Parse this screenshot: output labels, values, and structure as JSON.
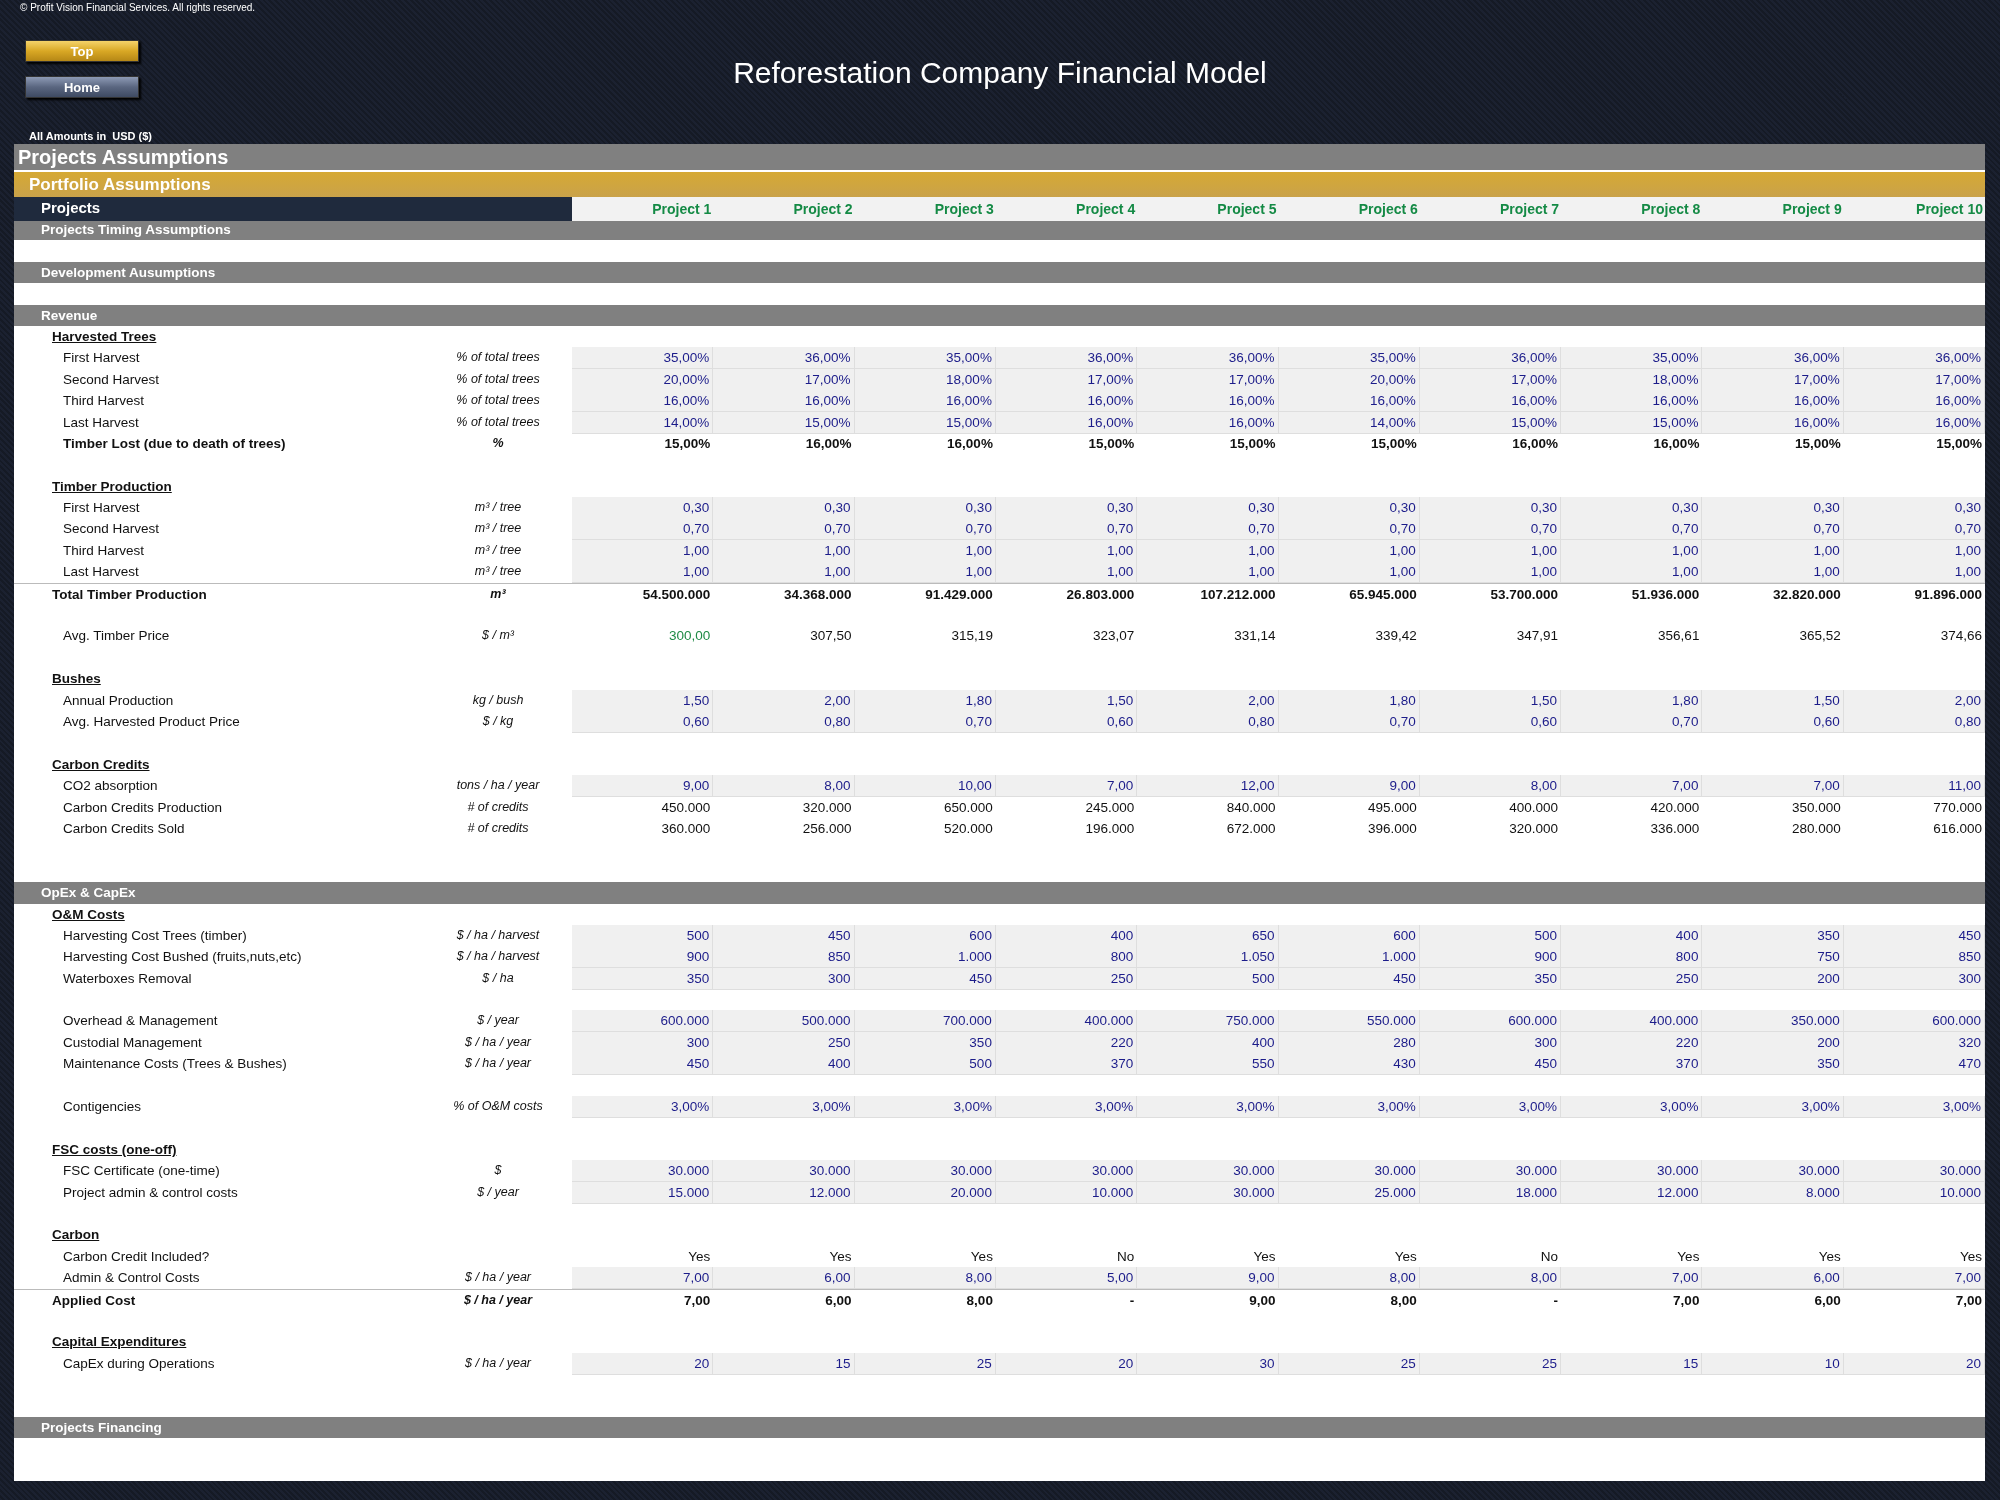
{
  "copyright": "© Profit Vision Financial Services. All rights reserved.",
  "nav_buttons": [
    {
      "label": "Top",
      "kind": "gold"
    },
    {
      "label": "Home",
      "kind": "slate"
    }
  ],
  "title": "Reforestation Company Financial Model",
  "currency_note": "All Amounts in  USD ($)",
  "sheet_title": "Projects Assumptions",
  "subtitle": "Portfolio Assumptions",
  "header": {
    "label": "Projects",
    "columns": [
      "Project 1",
      "Project 2",
      "Project 3",
      "Project 4",
      "Project 5",
      "Project 6",
      "Project 7",
      "Project 8",
      "Project 9",
      "Project 10"
    ]
  },
  "rows": [
    {
      "kind": "section",
      "label": "Projects Timing Assumptions"
    },
    {
      "kind": "blank"
    },
    {
      "kind": "section",
      "label": "Development Ausumptions"
    },
    {
      "kind": "blank"
    },
    {
      "kind": "section",
      "label": "Revenue"
    },
    {
      "kind": "heading",
      "label": "Harvested Trees"
    },
    {
      "kind": "input",
      "label": "First Harvest",
      "unit": "% of total trees",
      "values": [
        "35,00%",
        "36,00%",
        "35,00%",
        "36,00%",
        "36,00%",
        "35,00%",
        "36,00%",
        "35,00%",
        "36,00%",
        "36,00%"
      ]
    },
    {
      "kind": "input",
      "label": "Second Harvest",
      "unit": "% of total trees",
      "values": [
        "20,00%",
        "17,00%",
        "18,00%",
        "17,00%",
        "17,00%",
        "20,00%",
        "17,00%",
        "18,00%",
        "17,00%",
        "17,00%"
      ]
    },
    {
      "kind": "input",
      "label": "Third Harvest",
      "unit": "% of total trees",
      "values": [
        "16,00%",
        "16,00%",
        "16,00%",
        "16,00%",
        "16,00%",
        "16,00%",
        "16,00%",
        "16,00%",
        "16,00%",
        "16,00%"
      ]
    },
    {
      "kind": "input",
      "label": "Last Harvest",
      "unit": "% of total trees",
      "values": [
        "14,00%",
        "15,00%",
        "15,00%",
        "16,00%",
        "16,00%",
        "14,00%",
        "15,00%",
        "15,00%",
        "16,00%",
        "16,00%"
      ]
    },
    {
      "kind": "calc_bold",
      "label": "Timber Lost (due to death of trees)",
      "unit": "%",
      "values": [
        "15,00%",
        "16,00%",
        "16,00%",
        "15,00%",
        "15,00%",
        "15,00%",
        "16,00%",
        "16,00%",
        "15,00%",
        "15,00%"
      ]
    },
    {
      "kind": "blank"
    },
    {
      "kind": "heading",
      "label": "Timber Production"
    },
    {
      "kind": "input",
      "label": "First Harvest",
      "unit": "m³ / tree",
      "values": [
        "0,30",
        "0,30",
        "0,30",
        "0,30",
        "0,30",
        "0,30",
        "0,30",
        "0,30",
        "0,30",
        "0,30"
      ]
    },
    {
      "kind": "input",
      "label": "Second Harvest",
      "unit": "m³ / tree",
      "values": [
        "0,70",
        "0,70",
        "0,70",
        "0,70",
        "0,70",
        "0,70",
        "0,70",
        "0,70",
        "0,70",
        "0,70"
      ]
    },
    {
      "kind": "input",
      "label": "Third Harvest",
      "unit": "m³ / tree",
      "values": [
        "1,00",
        "1,00",
        "1,00",
        "1,00",
        "1,00",
        "1,00",
        "1,00",
        "1,00",
        "1,00",
        "1,00"
      ]
    },
    {
      "kind": "input",
      "label": "Last Harvest",
      "unit": "m³ / tree",
      "values": [
        "1,00",
        "1,00",
        "1,00",
        "1,00",
        "1,00",
        "1,00",
        "1,00",
        "1,00",
        "1,00",
        "1,00"
      ]
    },
    {
      "kind": "total",
      "label": "Total Timber Production",
      "unit": "m³",
      "values": [
        "54.500.000",
        "34.368.000",
        "91.429.000",
        "26.803.000",
        "107.212.000",
        "65.945.000",
        "53.700.000",
        "51.936.000",
        "32.820.000",
        "91.896.000"
      ]
    },
    {
      "kind": "blank"
    },
    {
      "kind": "price",
      "label": "Avg. Timber Price",
      "unit": "$ / m³",
      "values": [
        "300,00",
        "307,50",
        "315,19",
        "323,07",
        "331,14",
        "339,42",
        "347,91",
        "356,61",
        "365,52",
        "374,66"
      ]
    },
    {
      "kind": "blank"
    },
    {
      "kind": "heading",
      "label": "Bushes"
    },
    {
      "kind": "input",
      "label": "Annual Production",
      "unit": "kg / bush",
      "values": [
        "1,50",
        "2,00",
        "1,80",
        "1,50",
        "2,00",
        "1,80",
        "1,50",
        "1,80",
        "1,50",
        "2,00"
      ]
    },
    {
      "kind": "input",
      "label": "Avg. Harvested Product Price",
      "unit": "$  / kg",
      "values": [
        "0,60",
        "0,80",
        "0,70",
        "0,60",
        "0,80",
        "0,70",
        "0,60",
        "0,70",
        "0,60",
        "0,80"
      ]
    },
    {
      "kind": "blank"
    },
    {
      "kind": "heading",
      "label": "Carbon Credits"
    },
    {
      "kind": "input",
      "label": "CO2 absorption",
      "unit": "tons / ha / year",
      "values": [
        "9,00",
        "8,00",
        "10,00",
        "7,00",
        "12,00",
        "9,00",
        "8,00",
        "7,00",
        "7,00",
        "11,00"
      ]
    },
    {
      "kind": "calc",
      "label": "Carbon Credits Production",
      "unit": "# of credits",
      "values": [
        "450.000",
        "320.000",
        "650.000",
        "245.000",
        "840.000",
        "495.000",
        "400.000",
        "420.000",
        "350.000",
        "770.000"
      ]
    },
    {
      "kind": "calc",
      "label": "Carbon Credits Sold",
      "unit": "# of credits",
      "values": [
        "360.000",
        "256.000",
        "520.000",
        "196.000",
        "672.000",
        "396.000",
        "320.000",
        "336.000",
        "280.000",
        "616.000"
      ]
    },
    {
      "kind": "blank"
    },
    {
      "kind": "blank"
    },
    {
      "kind": "section",
      "label": "OpEx & CapEx"
    },
    {
      "kind": "heading",
      "label": "O&M Costs"
    },
    {
      "kind": "input",
      "label": "Harvesting Cost Trees (timber)",
      "unit": "$  / ha / harvest",
      "values": [
        "500",
        "450",
        "600",
        "400",
        "650",
        "600",
        "500",
        "400",
        "350",
        "450"
      ]
    },
    {
      "kind": "input",
      "label": "Harvesting Cost Bushed (fruits,nuts,etc)",
      "unit": "$  / ha / harvest",
      "values": [
        "900",
        "850",
        "1.000",
        "800",
        "1.050",
        "1.000",
        "900",
        "800",
        "750",
        "850"
      ]
    },
    {
      "kind": "input",
      "label": "Waterboxes Removal",
      "unit": "$  / ha",
      "values": [
        "350",
        "300",
        "450",
        "250",
        "500",
        "450",
        "350",
        "250",
        "200",
        "300"
      ]
    },
    {
      "kind": "blank"
    },
    {
      "kind": "input",
      "label": "Overhead & Management",
      "unit": "$  / year",
      "values": [
        "600.000",
        "500.000",
        "700.000",
        "400.000",
        "750.000",
        "550.000",
        "600.000",
        "400.000",
        "350.000",
        "600.000"
      ]
    },
    {
      "kind": "input",
      "label": "Custodial Management",
      "unit": "$  / ha / year",
      "values": [
        "300",
        "250",
        "350",
        "220",
        "400",
        "280",
        "300",
        "220",
        "200",
        "320"
      ]
    },
    {
      "kind": "input",
      "label": "Maintenance Costs (Trees & Bushes)",
      "unit": "$  / ha / year",
      "values": [
        "450",
        "400",
        "500",
        "370",
        "550",
        "430",
        "450",
        "370",
        "350",
        "470"
      ]
    },
    {
      "kind": "blank"
    },
    {
      "kind": "input",
      "label": "Contigencies",
      "unit": "% of O&M costs",
      "values": [
        "3,00%",
        "3,00%",
        "3,00%",
        "3,00%",
        "3,00%",
        "3,00%",
        "3,00%",
        "3,00%",
        "3,00%",
        "3,00%"
      ]
    },
    {
      "kind": "blank"
    },
    {
      "kind": "heading",
      "label": "FSC costs (one-off)"
    },
    {
      "kind": "input",
      "label": "FSC Certificate (one-time)",
      "unit": "$",
      "values": [
        "30.000",
        "30.000",
        "30.000",
        "30.000",
        "30.000",
        "30.000",
        "30.000",
        "30.000",
        "30.000",
        "30.000"
      ]
    },
    {
      "kind": "input",
      "label": "Project admin & control costs",
      "unit": "$  / year",
      "values": [
        "15.000",
        "12.000",
        "20.000",
        "10.000",
        "30.000",
        "25.000",
        "18.000",
        "12.000",
        "8.000",
        "10.000"
      ]
    },
    {
      "kind": "blank"
    },
    {
      "kind": "heading",
      "label": "Carbon"
    },
    {
      "kind": "calc",
      "label": "Carbon Credit Included?",
      "values": [
        "Yes",
        "Yes",
        "Yes",
        "No",
        "Yes",
        "Yes",
        "No",
        "Yes",
        "Yes",
        "Yes"
      ]
    },
    {
      "kind": "input",
      "label": "Admin & Control Costs",
      "unit": "$  / ha / year",
      "values": [
        "7,00",
        "6,00",
        "8,00",
        "5,00",
        "9,00",
        "8,00",
        "8,00",
        "7,00",
        "6,00",
        "7,00"
      ]
    },
    {
      "kind": "total",
      "label": "Applied Cost",
      "unit": "$  / ha / year",
      "values": [
        "7,00",
        "6,00",
        "8,00",
        "-",
        "9,00",
        "8,00",
        "-",
        "7,00",
        "6,00",
        "7,00"
      ]
    },
    {
      "kind": "blank"
    },
    {
      "kind": "heading",
      "label": "Capital Expenditures"
    },
    {
      "kind": "input",
      "label": "CapEx during Operations",
      "unit": "$  / ha / year",
      "values": [
        "20",
        "15",
        "25",
        "20",
        "30",
        "25",
        "25",
        "15",
        "10",
        "20"
      ]
    },
    {
      "kind": "blank"
    },
    {
      "kind": "blank"
    },
    {
      "kind": "section",
      "label": "Projects Financing"
    },
    {
      "kind": "blank"
    },
    {
      "kind": "blank"
    }
  ]
}
